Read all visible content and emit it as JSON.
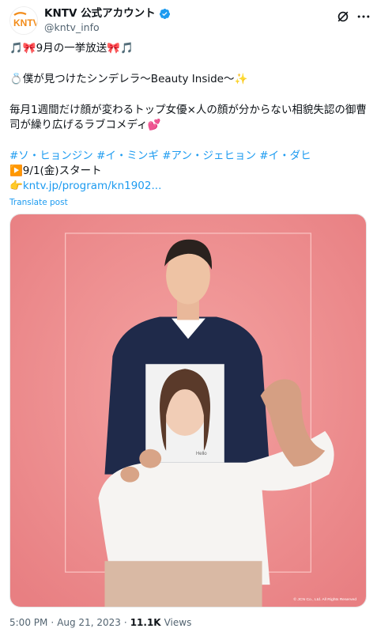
{
  "author": {
    "logo_text": "KNTV",
    "display_name": "KNTV 公式アカウント",
    "handle": "@kntv_info"
  },
  "icons": {
    "grok": "grok-icon",
    "more": "more-icon",
    "verified": "verified-badge-icon"
  },
  "tweet": {
    "line1": "🎵🎀9月の一挙放送🎀🎵",
    "line2": "💍僕が見つけたシンデレラ～Beauty Inside～✨",
    "line3": "毎月1週間だけ顔が変わるトップ女優×人の顔が分からない相貌失認の御曹司が繰り広げるラブコメディ💕",
    "hashtags": [
      "#ソ・ヒョンジン",
      "#イ・ミンギ",
      "#アン・ジェヒョン",
      "#イ・ダヒ"
    ],
    "start_line": "▶️9/1(金)スタート",
    "link_emoji": "👉",
    "link_text": "kntv.jp/program/kn1902..."
  },
  "translate_label": "Translate post",
  "media": {
    "alt": "Drama promotional poster",
    "copyright": "© JCN Co., Ltd. All Rights Reserved",
    "photo_card_text": "Hello"
  },
  "footer": {
    "time": "5:00 PM",
    "separator": "·",
    "date": "Aug 21, 2023",
    "views_count": "11.1K",
    "views_label": "Views"
  },
  "colors": {
    "accent": "#1d9bf0",
    "poster_bg": "#ee8c8e",
    "logo_orange": "#f28c1a"
  }
}
